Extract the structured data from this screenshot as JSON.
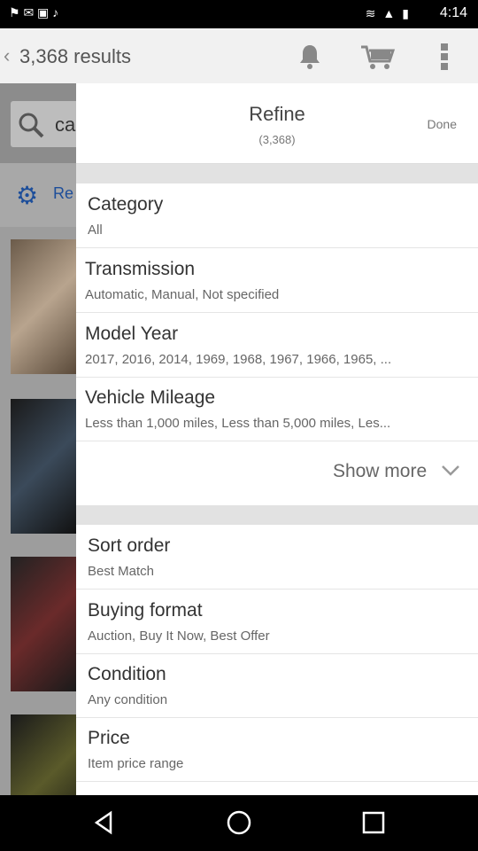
{
  "status": {
    "time": "4:14"
  },
  "appbar": {
    "title": "3,368 results"
  },
  "background": {
    "search_text": "ca",
    "refine_label": "Re"
  },
  "refine": {
    "title": "Refine",
    "count": "(3,368)",
    "done_label": "Done",
    "items": [
      {
        "label": "Category",
        "value": "All"
      },
      {
        "label": "Transmission",
        "value": "Automatic, Manual, Not specified"
      },
      {
        "label": "Model Year",
        "value": "2017, 2016, 2014, 1969, 1968, 1967, 1966, 1965, ..."
      },
      {
        "label": "Vehicle Mileage",
        "value": "Less than 1,000 miles, Less than 5,000 miles, Les..."
      }
    ],
    "show_more": "Show more",
    "sort_items": [
      {
        "label": "Sort order",
        "value": "Best Match"
      },
      {
        "label": "Buying format",
        "value": "Auction, Buy It Now, Best Offer"
      },
      {
        "label": "Condition",
        "value": "Any condition"
      },
      {
        "label": "Price",
        "value": "Item price range"
      }
    ]
  },
  "icons": {
    "bell": "bell-icon",
    "cart": "cart-icon",
    "more": "more-vert-icon"
  }
}
